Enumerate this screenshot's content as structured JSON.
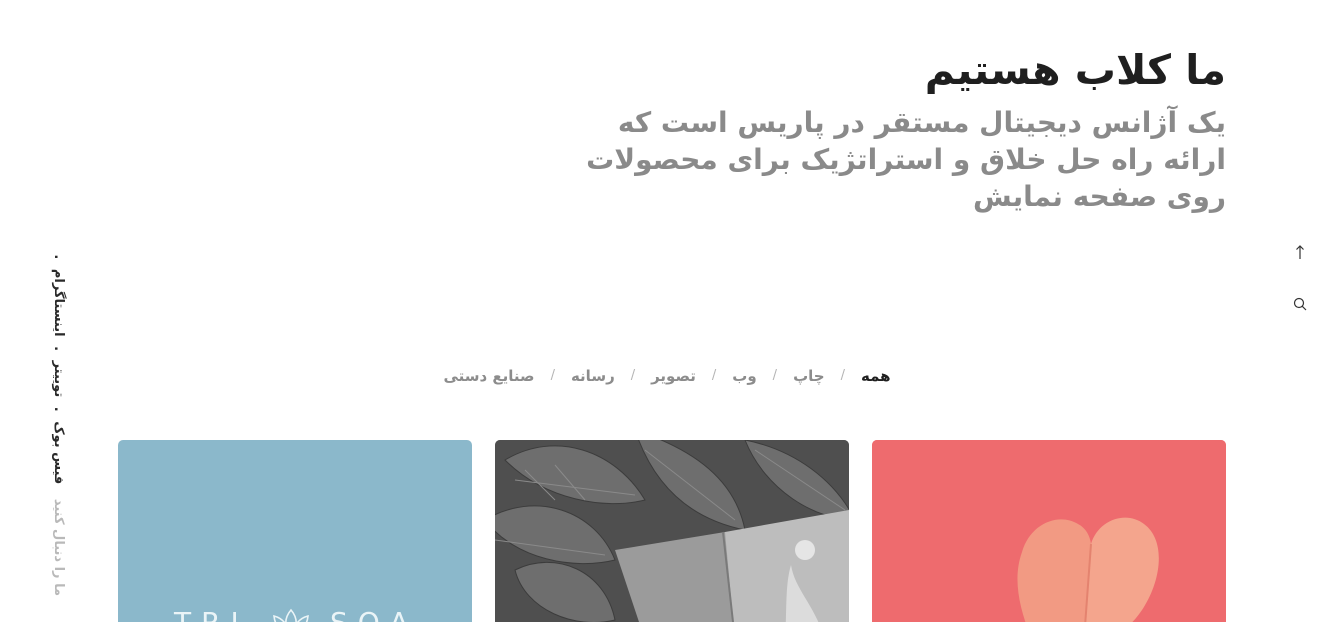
{
  "hero": {
    "title": "ما کلاب هستیم",
    "subtitle": "یک آژانس دیجیتال مستقر در پاریس است که ارائه راه حل خلاق و استراتژیک برای محصولات روی صفحه نمایش"
  },
  "side_tools": {
    "icons": [
      "arrow-up-icon",
      "search-icon"
    ]
  },
  "social": {
    "follow_label": "ما را دنبال کنید",
    "links": [
      "فیس بوک",
      "توییتر",
      "اینستاگرام"
    ]
  },
  "filters": {
    "items": [
      "همه",
      "چاپ",
      "وب",
      "تصویر",
      "رسانه",
      "صنایع دستی"
    ],
    "active": "همه"
  },
  "cards": [
    {
      "name": "card-trisoa",
      "color": "#8bb8cb",
      "logo_text": "TRI SOA"
    },
    {
      "name": "card-magazine",
      "color": "#5a5a5a"
    },
    {
      "name": "card-heart",
      "color": "#ee6b6e"
    }
  ]
}
